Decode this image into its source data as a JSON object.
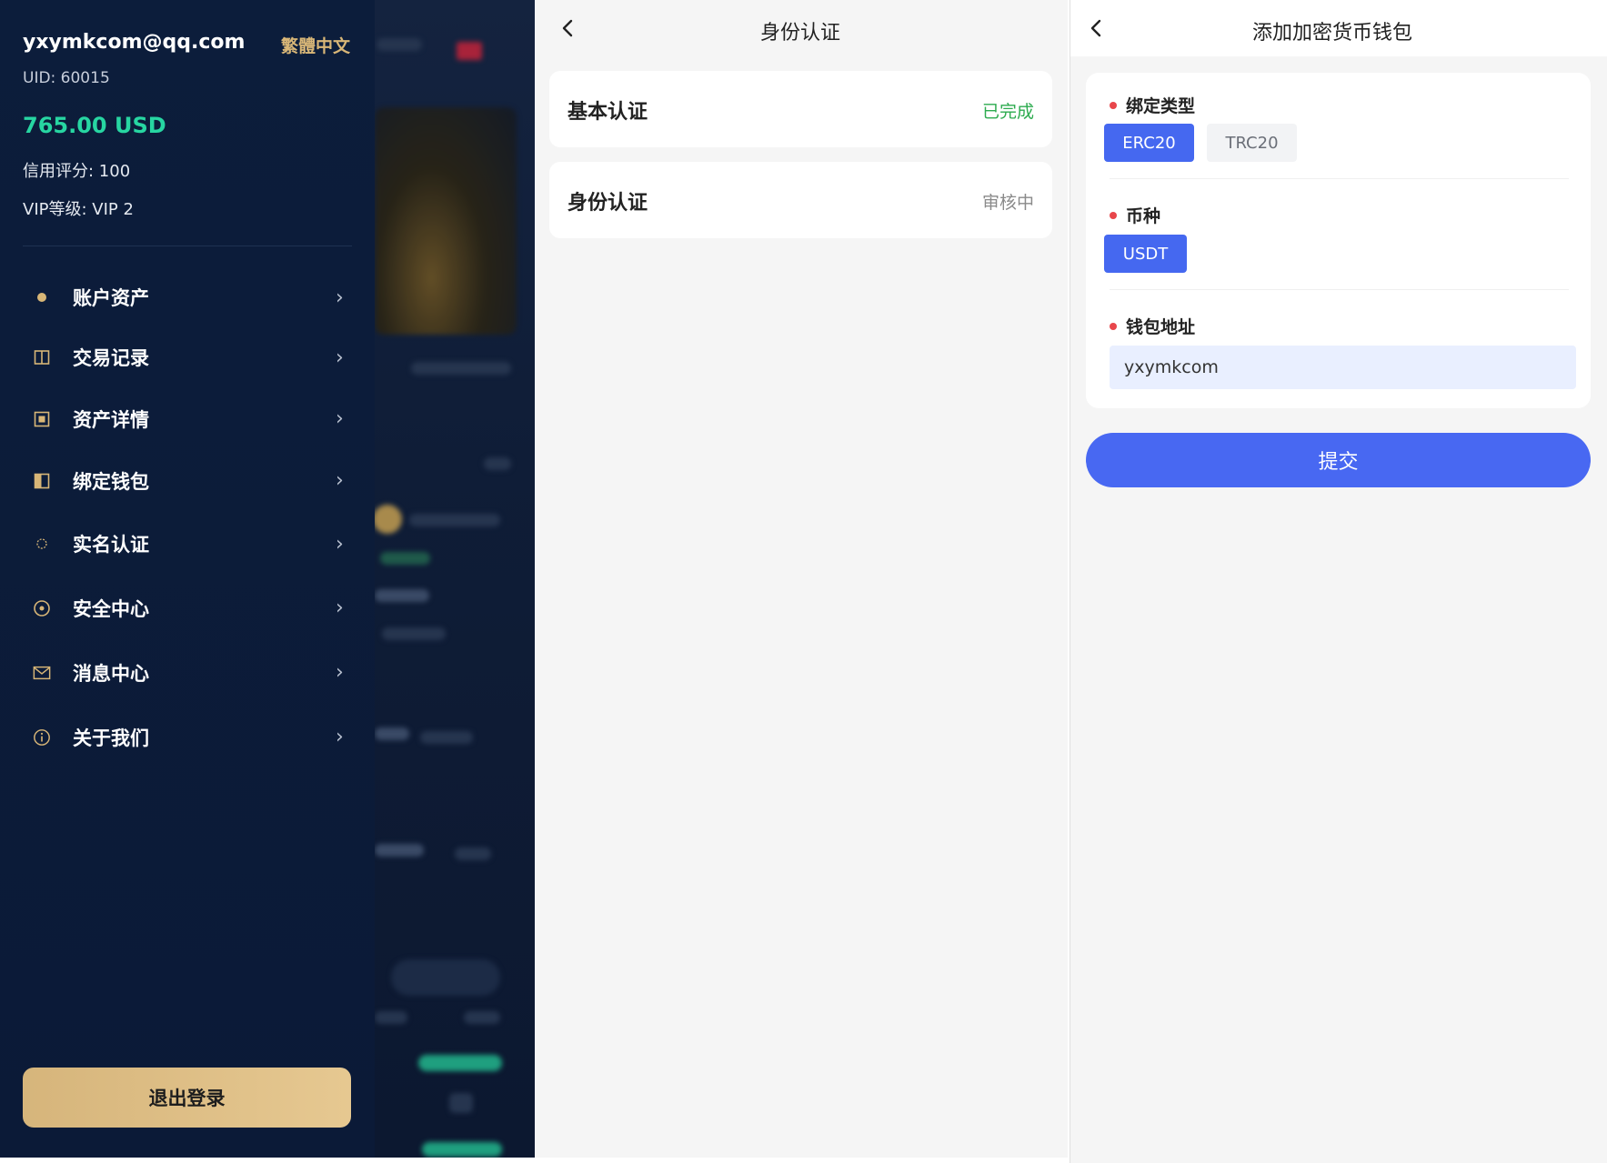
{
  "drawer": {
    "email": "yxymkcom@qq.com",
    "language": "繁體中文",
    "uid": "UID: 60015",
    "balance": "765.00 USD",
    "credit_score": "信用评分: 100",
    "vip_level": "VIP等级: VIP 2",
    "menu": [
      {
        "label": "账户资产",
        "icon": "dot-icon"
      },
      {
        "label": "交易记录",
        "icon": "book-icon"
      },
      {
        "label": "资产详情",
        "icon": "square-icon"
      },
      {
        "label": "绑定钱包",
        "icon": "wallet-icon"
      },
      {
        "label": "实名认证",
        "icon": "circle-icon"
      },
      {
        "label": "安全中心",
        "icon": "target-icon"
      },
      {
        "label": "消息中心",
        "icon": "mail-icon"
      },
      {
        "label": "关于我们",
        "icon": "info-icon"
      }
    ],
    "chevron": "›",
    "logout_label": "退出登录",
    "accent_color": "#d8b677",
    "balance_color": "#27d6a2"
  },
  "verification": {
    "title": "身份认证",
    "items": [
      {
        "label": "基本认证",
        "status": "已完成",
        "status_color": "#2dab4f"
      },
      {
        "label": "身份认证",
        "status": "审核中",
        "status_color": "#8a8a8a"
      }
    ]
  },
  "wallet_form": {
    "title": "添加加密货币钱包",
    "bind_type_label": "绑定类型",
    "bind_types": [
      "ERC20",
      "TRC20"
    ],
    "selected_bind_type": "ERC20",
    "currency_label": "币种",
    "currencies": [
      "USDT"
    ],
    "address_label": "钱包地址",
    "address_value": "yxymkcom",
    "submit_label": "提交",
    "primary_color": "#4868f2"
  }
}
